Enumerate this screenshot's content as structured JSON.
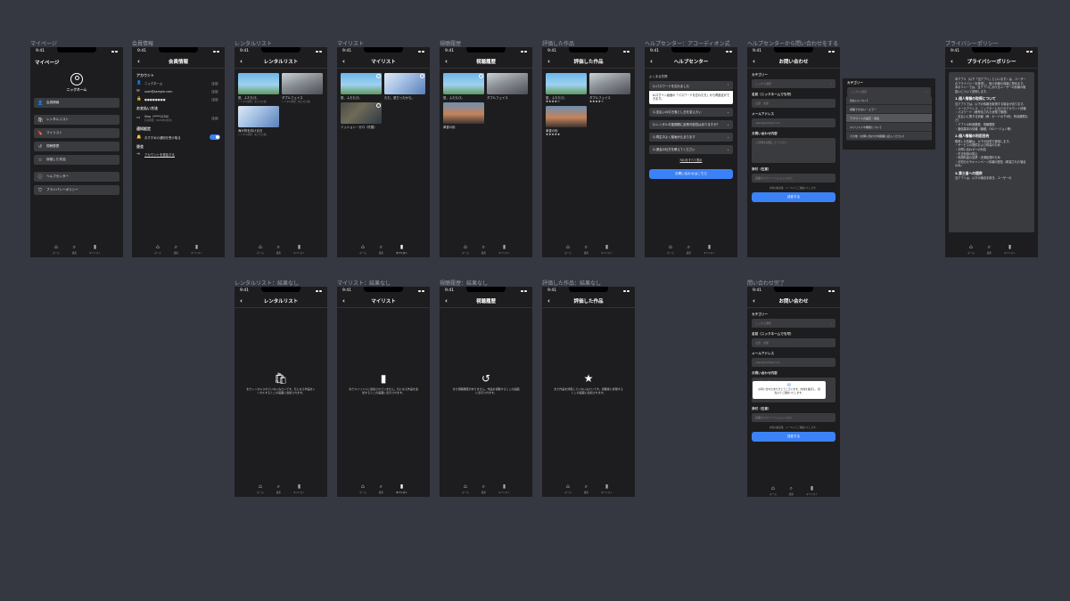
{
  "status_time": "9:41",
  "tabs": {
    "home": "ホーム",
    "search": "検索",
    "mylist": "マイリスト"
  },
  "labels": {
    "mypage": "マイページ",
    "member": "会員情報",
    "rental": "レンタルリスト",
    "mylist": "マイリスト",
    "history": "視聴履歴",
    "rated": "評価した作品",
    "help": "ヘルプセンター：アコーディオン式",
    "contact": "ヘルプセンターから問い合わせをする",
    "privacy": "プライバシーポリシー",
    "rental_empty": "レンタルリスト：結果なし",
    "mylist_empty": "マイリスト：結果なし",
    "history_empty": "視聴履歴：結果なし",
    "rated_empty": "評価した作品：結果なし",
    "contact_done": "問い合わせ完了"
  },
  "mypage": {
    "title": "マイページ",
    "nickname": "ニックネーム",
    "menu": [
      "会員情報",
      "レンタルリスト",
      "マイリスト",
      "視聴履歴",
      "評価した作品",
      "ヘルプセンター",
      "プライバシーポリシー"
    ]
  },
  "member": {
    "title": "会員情報",
    "account": "アカウント",
    "nickname": "ニックネーム",
    "email": "user@sample.com",
    "password": "●●●●●●●●",
    "change": "［変更］",
    "payment": "お支払い方法",
    "card": "Visa（****1234）",
    "card_exp": "有効期限：2025年6月(仮)",
    "notice": "通知設定",
    "notice_item": "おすすめの通知を受け取る",
    "withdraw": "退会",
    "withdraw_link": "アカウントを退会する"
  },
  "rental": {
    "title": "レンタルリスト",
    "items": [
      {
        "title": "夏、ふたたび。",
        "sub": "レンタル期限：あと3日(仮)"
      },
      {
        "title": "ダブルフェイス",
        "sub": "レンタル期限：あと5日(仮)"
      },
      {
        "title": "海が背を向ける日",
        "sub": "レンタル期限：あと5日(仮)"
      }
    ]
  },
  "mylist": {
    "title": "マイリスト",
    "items": [
      {
        "title": "夏、ふたたび。"
      },
      {
        "title": "ただ、夏だったから。"
      },
      {
        "title": "ミッション・ゼロ（吹替）"
      }
    ]
  },
  "history": {
    "title": "視聴履歴",
    "items": [
      {
        "title": "夏、ふたたび。"
      },
      {
        "title": "ダブルフェイス"
      },
      {
        "title": "黄昏の街"
      }
    ]
  },
  "rated": {
    "title": "評価した作品",
    "items": [
      {
        "title": "夏、ふたたび。",
        "stars": "★★★★☆"
      },
      {
        "title": "ダブルフェイス",
        "stars": "★★★★☆"
      },
      {
        "title": "黄昏の街",
        "stars": "★★★★★"
      }
    ]
  },
  "help": {
    "title": "ヘルプセンター",
    "faq": "よくある質問",
    "q1": "Q.パスワードを忘れました",
    "a1": "A.ログイン画面の「パスワードを忘れた方」から再設定ができます。",
    "questions": [
      "Q.支払いの引き落とし日を変えたい",
      "Q.レンタル可能期間に延長可能性はありますか？",
      "Q.再生中よく動画が止まります",
      "Q.退会の仕方を教えてください"
    ],
    "all_faq": "FAQをすべて表示",
    "contact_btn": "お問い合わせはこちら"
  },
  "contact": {
    "title": "お問い合わせ",
    "category": "カテゴリー",
    "category_ph": "ここから選択",
    "name": "名前（ニックネームでも可）",
    "name_ph": "山田　太郎",
    "email": "メールアドレス",
    "email_ph": "user@sample.com",
    "body": "お問い合わせ内容",
    "body_ph": "ご質問を記載してください",
    "attach": "添付（任意）",
    "attach_ph": "画面のスクリーンショットなど",
    "note": "内容の確認後、メールにてご連絡いたします。",
    "submit": "送信する",
    "options": [
      "支払いについて",
      "視聴できない・エラー",
      "アカウントの設定・退会",
      "マイリストや機能について",
      "その他（お問い合わせ内容欄に記入ください）"
    ],
    "done_msg": "お問い合わせありがとうございます。内容を確認し、担当よりご連絡いたします。"
  },
  "privacy": {
    "title": "プライバシーポリシー",
    "intro": "本アプリ（以下「当アプリ」といいます）は、ユーザーのプライバシーを尊重し、個人情報の保護に努めます。本ポリシーでは、当アプリにおけるユーザーの情報の取扱いについて説明します。",
    "h1": "1.個人情報の取得について",
    "p1": "当アプリでは、以下の情報を取得する場合があります。",
    "l1": [
      "・メールアドレス、ニックネームなどのアカウント情報",
      "・パスワード（暗号化された状態で管理）",
      "・支払いに関する情報（例：カードの下4桁、有効期限など）",
      "・アプリの利用履歴、視聴履歴",
      "・通信端末の情報（機種、OSバージョン等）"
    ],
    "h2": "2.個人情報の利用目的",
    "p2": "取得した情報は、以下の目的で使用します。",
    "l2": [
      "・サービスの提供および改善のため",
      "・お問い合わせへの対応",
      "・不正利用の防止",
      "・利用料金の請求・決済処理のため",
      "・お知らせやキャンペーン情報の配信（希望された場合のみ）"
    ],
    "h3": "3.第三者への提供",
    "p3": "当アプリは、以下の場合を除き、ユーザーの"
  },
  "empty": {
    "rental": "まだレンタルされていないみたいです。気になる作品をレンタルするとこの画面に追加されます。",
    "mylist": "まだマイリストに追加されていません。気になる作品を追加するとこの画面に表示されます。",
    "history": "まだ視聴履歴がありません。作品を視聴するとこの画面に表示されます。",
    "rated": "まだ作品を評価していないみたいです。視聴後に評価するとこの画面に追加されます。"
  }
}
